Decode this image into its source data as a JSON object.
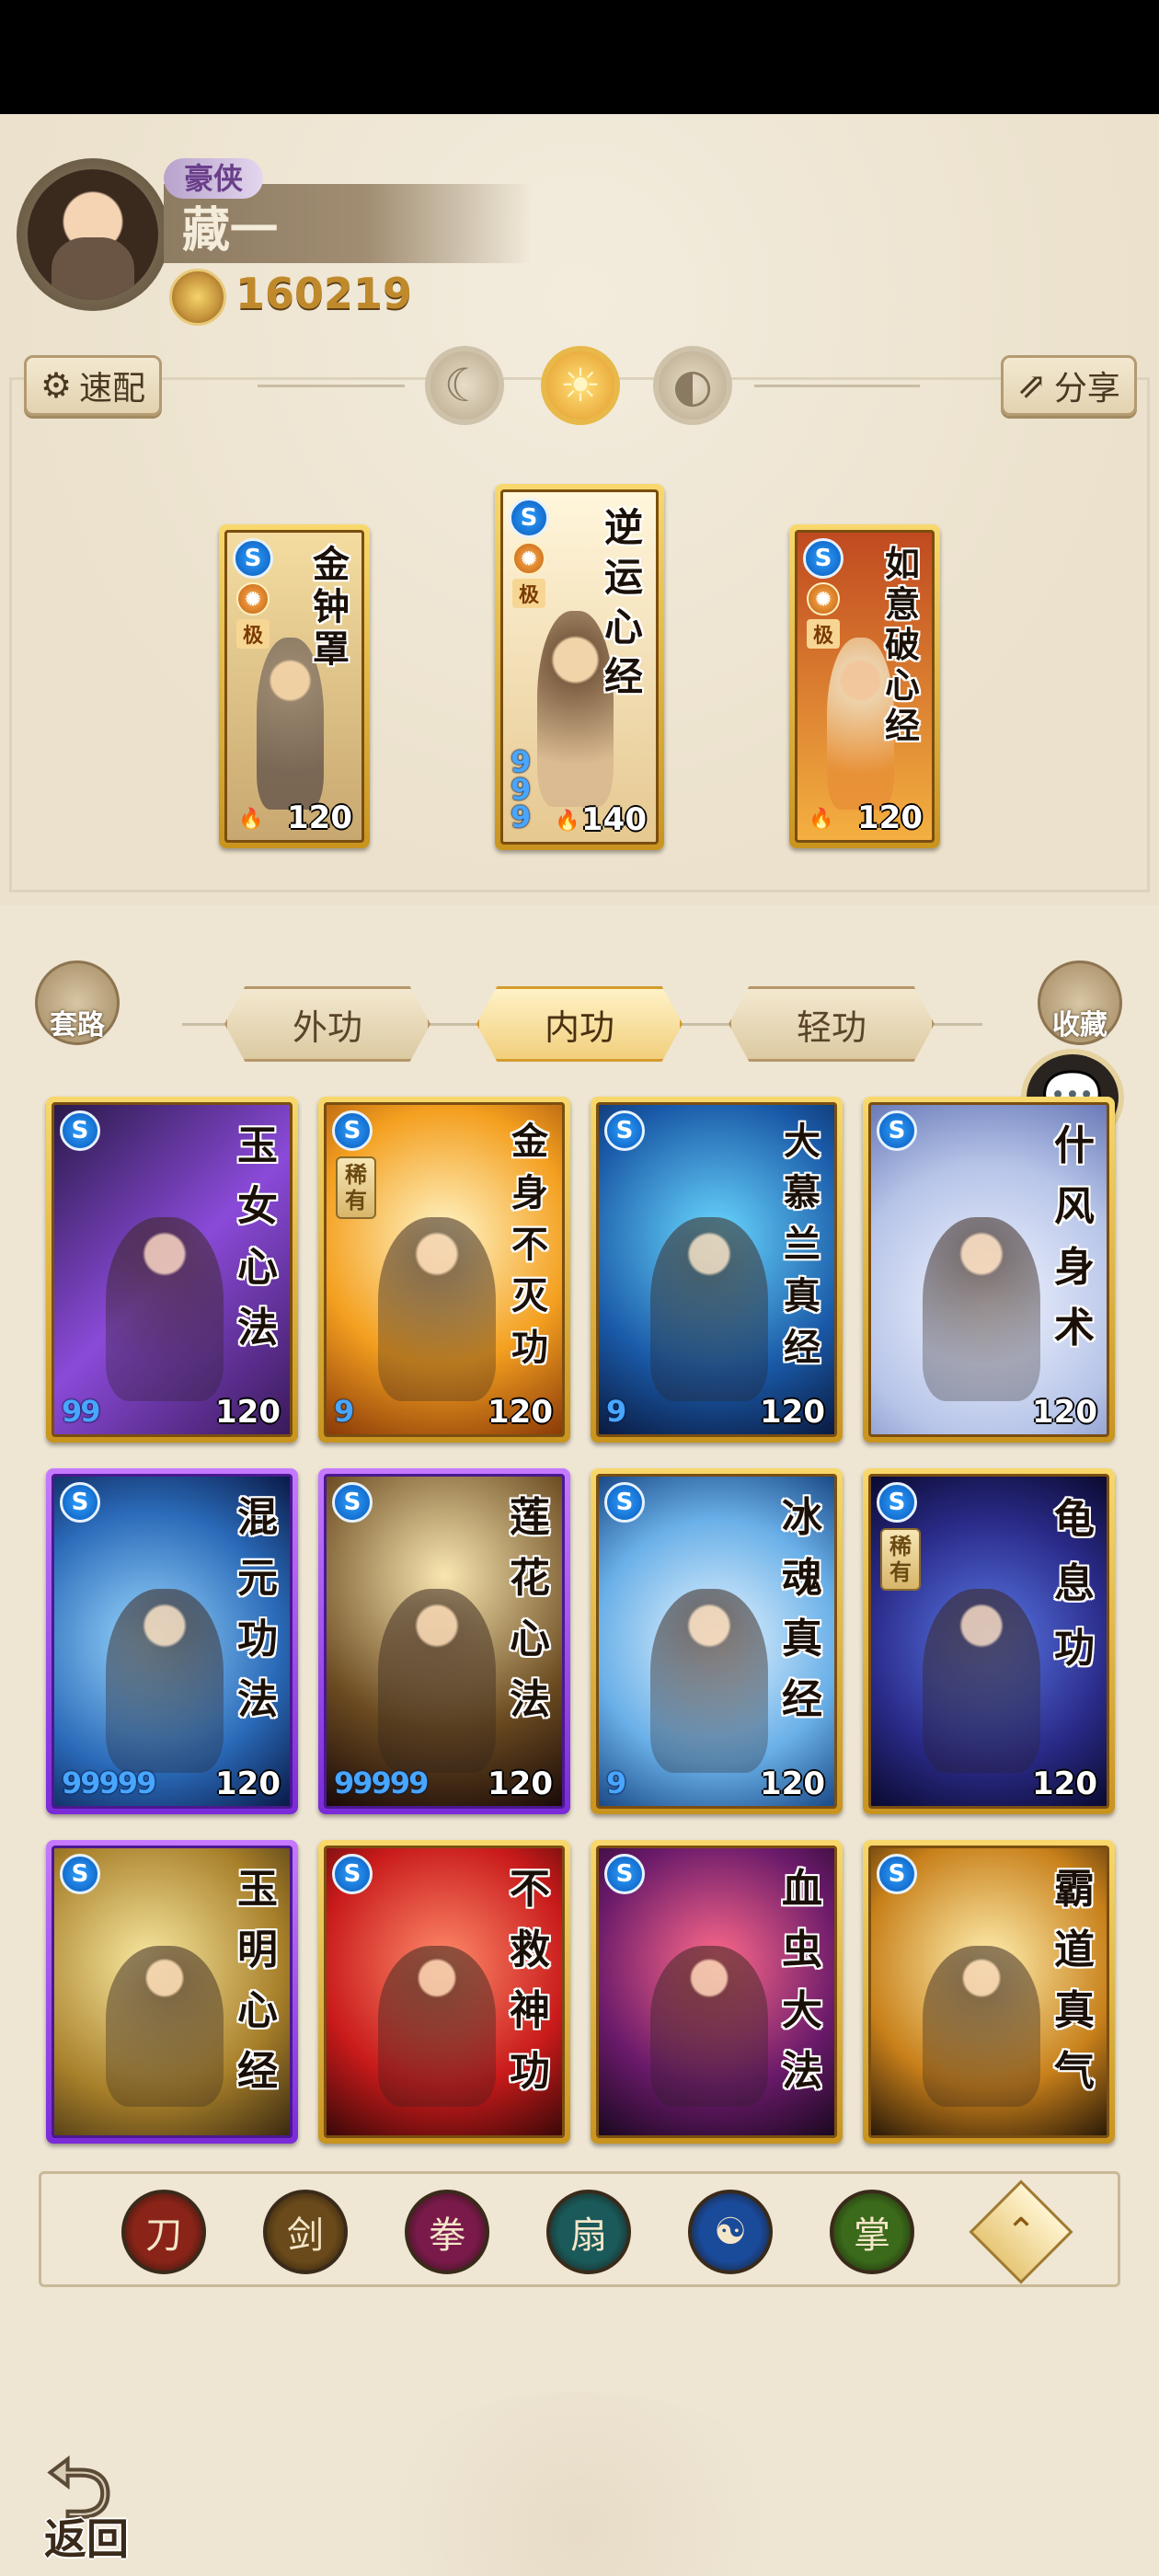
{
  "profile": {
    "title": "豪侠",
    "name": "藏一",
    "coins": "160219"
  },
  "toolbar": {
    "quick_label": "速配",
    "share_label": "分享"
  },
  "modes": [
    {
      "icon": "☾"
    },
    {
      "icon": "☀"
    },
    {
      "icon": "◐"
    }
  ],
  "equipped": [
    {
      "title": "金钟罩",
      "level": "120",
      "tag": "极",
      "badge": "S"
    },
    {
      "title": "逆运心经",
      "level": "140",
      "tag": "极",
      "badge": "S",
      "stars": "9 9 9"
    },
    {
      "title": "如意破心经",
      "level": "120",
      "tag": "极",
      "badge": "S"
    }
  ],
  "side": {
    "left_label": "套路",
    "right_label": "收藏"
  },
  "tabs": [
    {
      "label": "外功"
    },
    {
      "label": "内功"
    },
    {
      "label": "轻功"
    }
  ],
  "cards": [
    {
      "title": "玉女心法",
      "level": "120",
      "stars": "99",
      "rare": ""
    },
    {
      "title": "金身不灭功",
      "level": "120",
      "stars": "9",
      "rare": "稀有"
    },
    {
      "title": "大慕兰真经",
      "level": "120",
      "stars": "9",
      "rare": ""
    },
    {
      "title": "什风身术",
      "level": "120",
      "stars": "",
      "rare": ""
    },
    {
      "title": "混元功法",
      "level": "120",
      "stars": "99999",
      "rare": ""
    },
    {
      "title": "莲花心法",
      "level": "120",
      "stars": "99999",
      "rare": ""
    },
    {
      "title": "冰魂真经",
      "level": "120",
      "stars": "9",
      "rare": ""
    },
    {
      "title": "龟息功",
      "level": "120",
      "stars": "",
      "rare": "稀有"
    },
    {
      "title": "玉明心经",
      "level": "",
      "stars": "",
      "rare": ""
    },
    {
      "title": "不救神功",
      "level": "",
      "stars": "",
      "rare": ""
    },
    {
      "title": "血虫大法",
      "level": "",
      "stars": "",
      "rare": ""
    },
    {
      "title": "霸道真气",
      "level": "",
      "stars": "",
      "rare": ""
    }
  ],
  "filters": [
    {
      "icon": "刀",
      "color": "#8a2418"
    },
    {
      "icon": "剑",
      "color": "#6a4a1a"
    },
    {
      "icon": "拳",
      "color": "#7a1a4a"
    },
    {
      "icon": "扇",
      "color": "#1a5a5a"
    },
    {
      "icon": "☯",
      "color": "#1a4a9a"
    },
    {
      "icon": "掌",
      "color": "#3a6a1a"
    }
  ],
  "back_label": "返回",
  "colors": {
    "gold": "#e0a830",
    "purple": "#8a3ae0",
    "blue_badge": "#1a78d8"
  }
}
